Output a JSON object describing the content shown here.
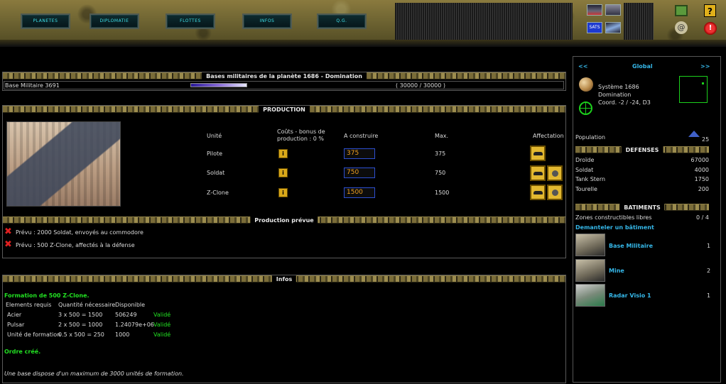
{
  "nav": {
    "buttons": [
      "PLANETES",
      "DIPLOMATIE",
      "FLOTTES",
      "INFOS",
      "Q.G."
    ]
  },
  "header": {
    "help_label": "?",
    "quit_label": "!",
    "mail_label": "@",
    "radar_label": "SATS"
  },
  "bases": {
    "title": "Bases militaires de la planète 1686 - Domination",
    "base_name": "Base Militaire 3691",
    "progress_text": "( 30000 / 30000 )",
    "progress_fraction": 1.0
  },
  "production": {
    "title": "PRODUCTION",
    "columns": {
      "unit": "Unité",
      "cost": "Coûts - bonus de production : 0 %",
      "to_build": "A construire",
      "max": "Max.",
      "assignment": "Affectation"
    },
    "rows": [
      {
        "unit": "Pilote",
        "qty": "375",
        "max": "375"
      },
      {
        "unit": "Soldat",
        "qty": "750",
        "max": "750"
      },
      {
        "unit": "Z-Clone",
        "qty": "1500",
        "max": "1500"
      }
    ],
    "info_icon": "i"
  },
  "planned": {
    "title": "Production prévue",
    "items": [
      "Prévu : 2000 Soldat, envoyés au commodore",
      "Prévu : 500 Z-Clone, affectés à la défense"
    ]
  },
  "infos": {
    "title": "Infos",
    "heading": "Formation de 500 Z-Clone.",
    "columns": [
      "Elements requis",
      "Quantité nécessaire",
      "Disponible"
    ],
    "rows": [
      {
        "element": "Acier",
        "needed": "3 x 500 = 1500",
        "available": "506249",
        "status": "Validé"
      },
      {
        "element": "Pulsar",
        "needed": "2 x 500 = 1000",
        "available": "1.24079e+06",
        "status": "Validé"
      },
      {
        "element": "Unité de formation",
        "needed": "0.5 x 500 = 250",
        "available": "1000",
        "status": "Validé"
      }
    ],
    "order_text": "Ordre créé.",
    "note": "Une base dispose d'un maximum de 3000 unités de formation."
  },
  "sidebar": {
    "prev": "<<",
    "title": "Global",
    "next": ">>",
    "system": "Système 1686",
    "planet": "Domination",
    "coords": "Coord. -2 / -24, D3",
    "population_label": "Population",
    "population_value": "25",
    "defenses_title": "DEFENSES",
    "defenses": [
      {
        "name": "Droïde",
        "value": "67000"
      },
      {
        "name": "Soldat",
        "value": "4000"
      },
      {
        "name": "Tank Stern",
        "value": "1750"
      },
      {
        "name": "Tourelle",
        "value": "200"
      }
    ],
    "buildings_title": "BATIMENTS",
    "zones_label": "Zones constructibles libres",
    "zones_value": "0 / 4",
    "dismantle_link": "Demanteler un bâtiment",
    "buildings": [
      {
        "name": "Base Militaire",
        "count": "1"
      },
      {
        "name": "Mine",
        "count": "2"
      },
      {
        "name": "Radar Visio 1",
        "count": "1"
      }
    ]
  },
  "colors": {
    "accent_cyan": "#35b7e8",
    "valid_green": "#22e022",
    "planned_red": "#e02020",
    "qty_orange": "#f0a020"
  }
}
